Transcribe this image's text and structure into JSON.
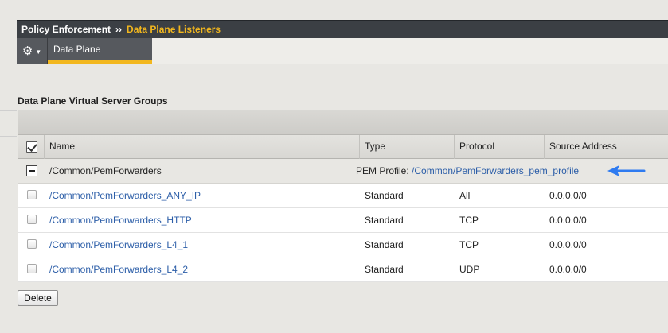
{
  "breadcrumb": {
    "parent": "Policy Enforcement",
    "separator": "››",
    "current": "Data Plane Listeners"
  },
  "toolbar": {
    "gear_icon": "gear-icon",
    "active_tab": "Data Plane"
  },
  "section": {
    "title": "Data Plane Virtual Server Groups"
  },
  "table": {
    "columns": [
      "Name",
      "Type",
      "Protocol",
      "Source Address"
    ],
    "group": {
      "name": "/Common/PemForwarders",
      "profile_label": "PEM Profile:",
      "profile_link": "/Common/PemForwarders_pem_profile"
    },
    "rows": [
      {
        "name": "/Common/PemForwarders_ANY_IP",
        "type": "Standard",
        "protocol": "All",
        "source": "0.0.0.0/0"
      },
      {
        "name": "/Common/PemForwarders_HTTP",
        "type": "Standard",
        "protocol": "TCP",
        "source": "0.0.0.0/0"
      },
      {
        "name": "/Common/PemForwarders_L4_1",
        "type": "Standard",
        "protocol": "TCP",
        "source": "0.0.0.0/0"
      },
      {
        "name": "/Common/PemForwarders_L4_2",
        "type": "Standard",
        "protocol": "UDP",
        "source": "0.0.0.0/0"
      }
    ]
  },
  "actions": {
    "delete_label": "Delete"
  },
  "colors": {
    "accent": "#f2b71e",
    "link": "#2c5ea8",
    "annotation_arrow": "#2f7bf0"
  }
}
